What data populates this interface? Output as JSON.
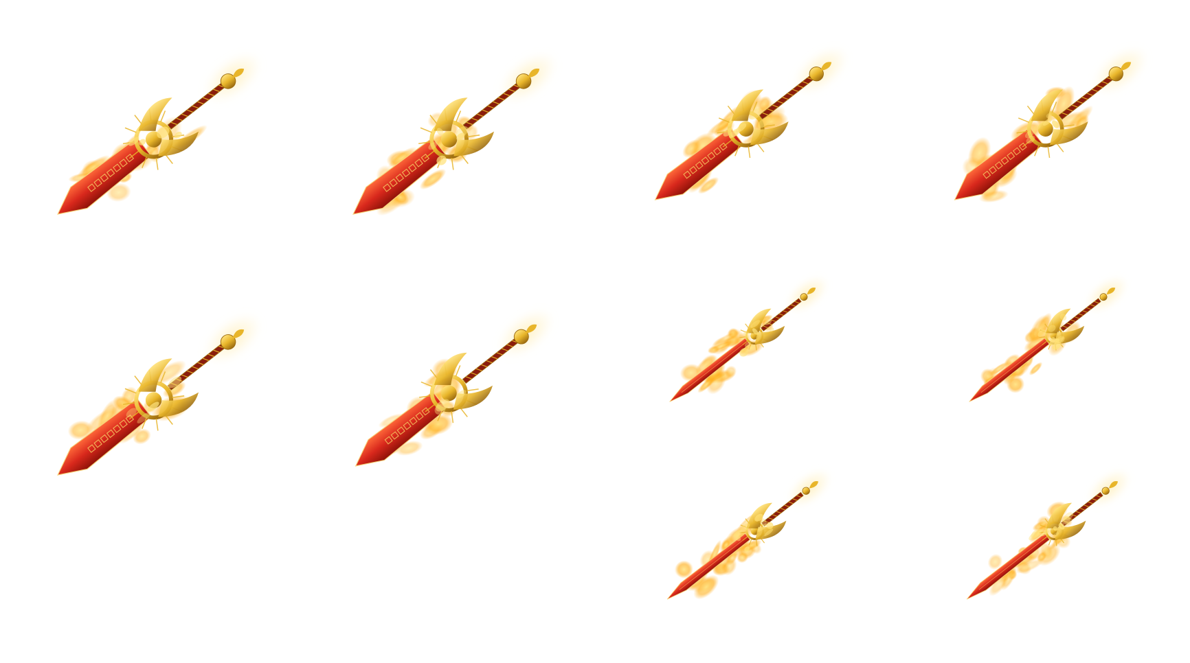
{
  "sprite_sheet": {
    "background": "#ffffff",
    "palette": {
      "blade_red": "#d8281c",
      "blade_dark": "#8e1208",
      "gold": "#e8b52a",
      "gold_dark": "#9a6a10",
      "flame": "#ffb020",
      "flame_light": "#ffe27a",
      "glow": "#fff0c0"
    },
    "sprites": [
      {
        "id": "sword-frame-1",
        "variant": "broad",
        "flame_level": 0.35
      },
      {
        "id": "sword-frame-2",
        "variant": "broad",
        "flame_level": 0.5
      },
      {
        "id": "sword-frame-3",
        "variant": "broad",
        "flame_level": 0.55
      },
      {
        "id": "sword-frame-4",
        "variant": "broad",
        "flame_level": 0.6
      },
      {
        "id": "sword-frame-5",
        "variant": "broad",
        "flame_level": 0.35
      },
      {
        "id": "sword-frame-6",
        "variant": "broad",
        "flame_level": 0.3
      },
      {
        "id": "sword-frame-7",
        "variant": "slim",
        "flame_level": 0.8
      },
      {
        "id": "sword-frame-8",
        "variant": "slim",
        "flame_level": 0.85
      },
      {
        "id": "sword-frame-9",
        "variant": "slim",
        "flame_level": 0.9
      },
      {
        "id": "sword-frame-10",
        "variant": "slim",
        "flame_level": 0.85
      }
    ]
  }
}
